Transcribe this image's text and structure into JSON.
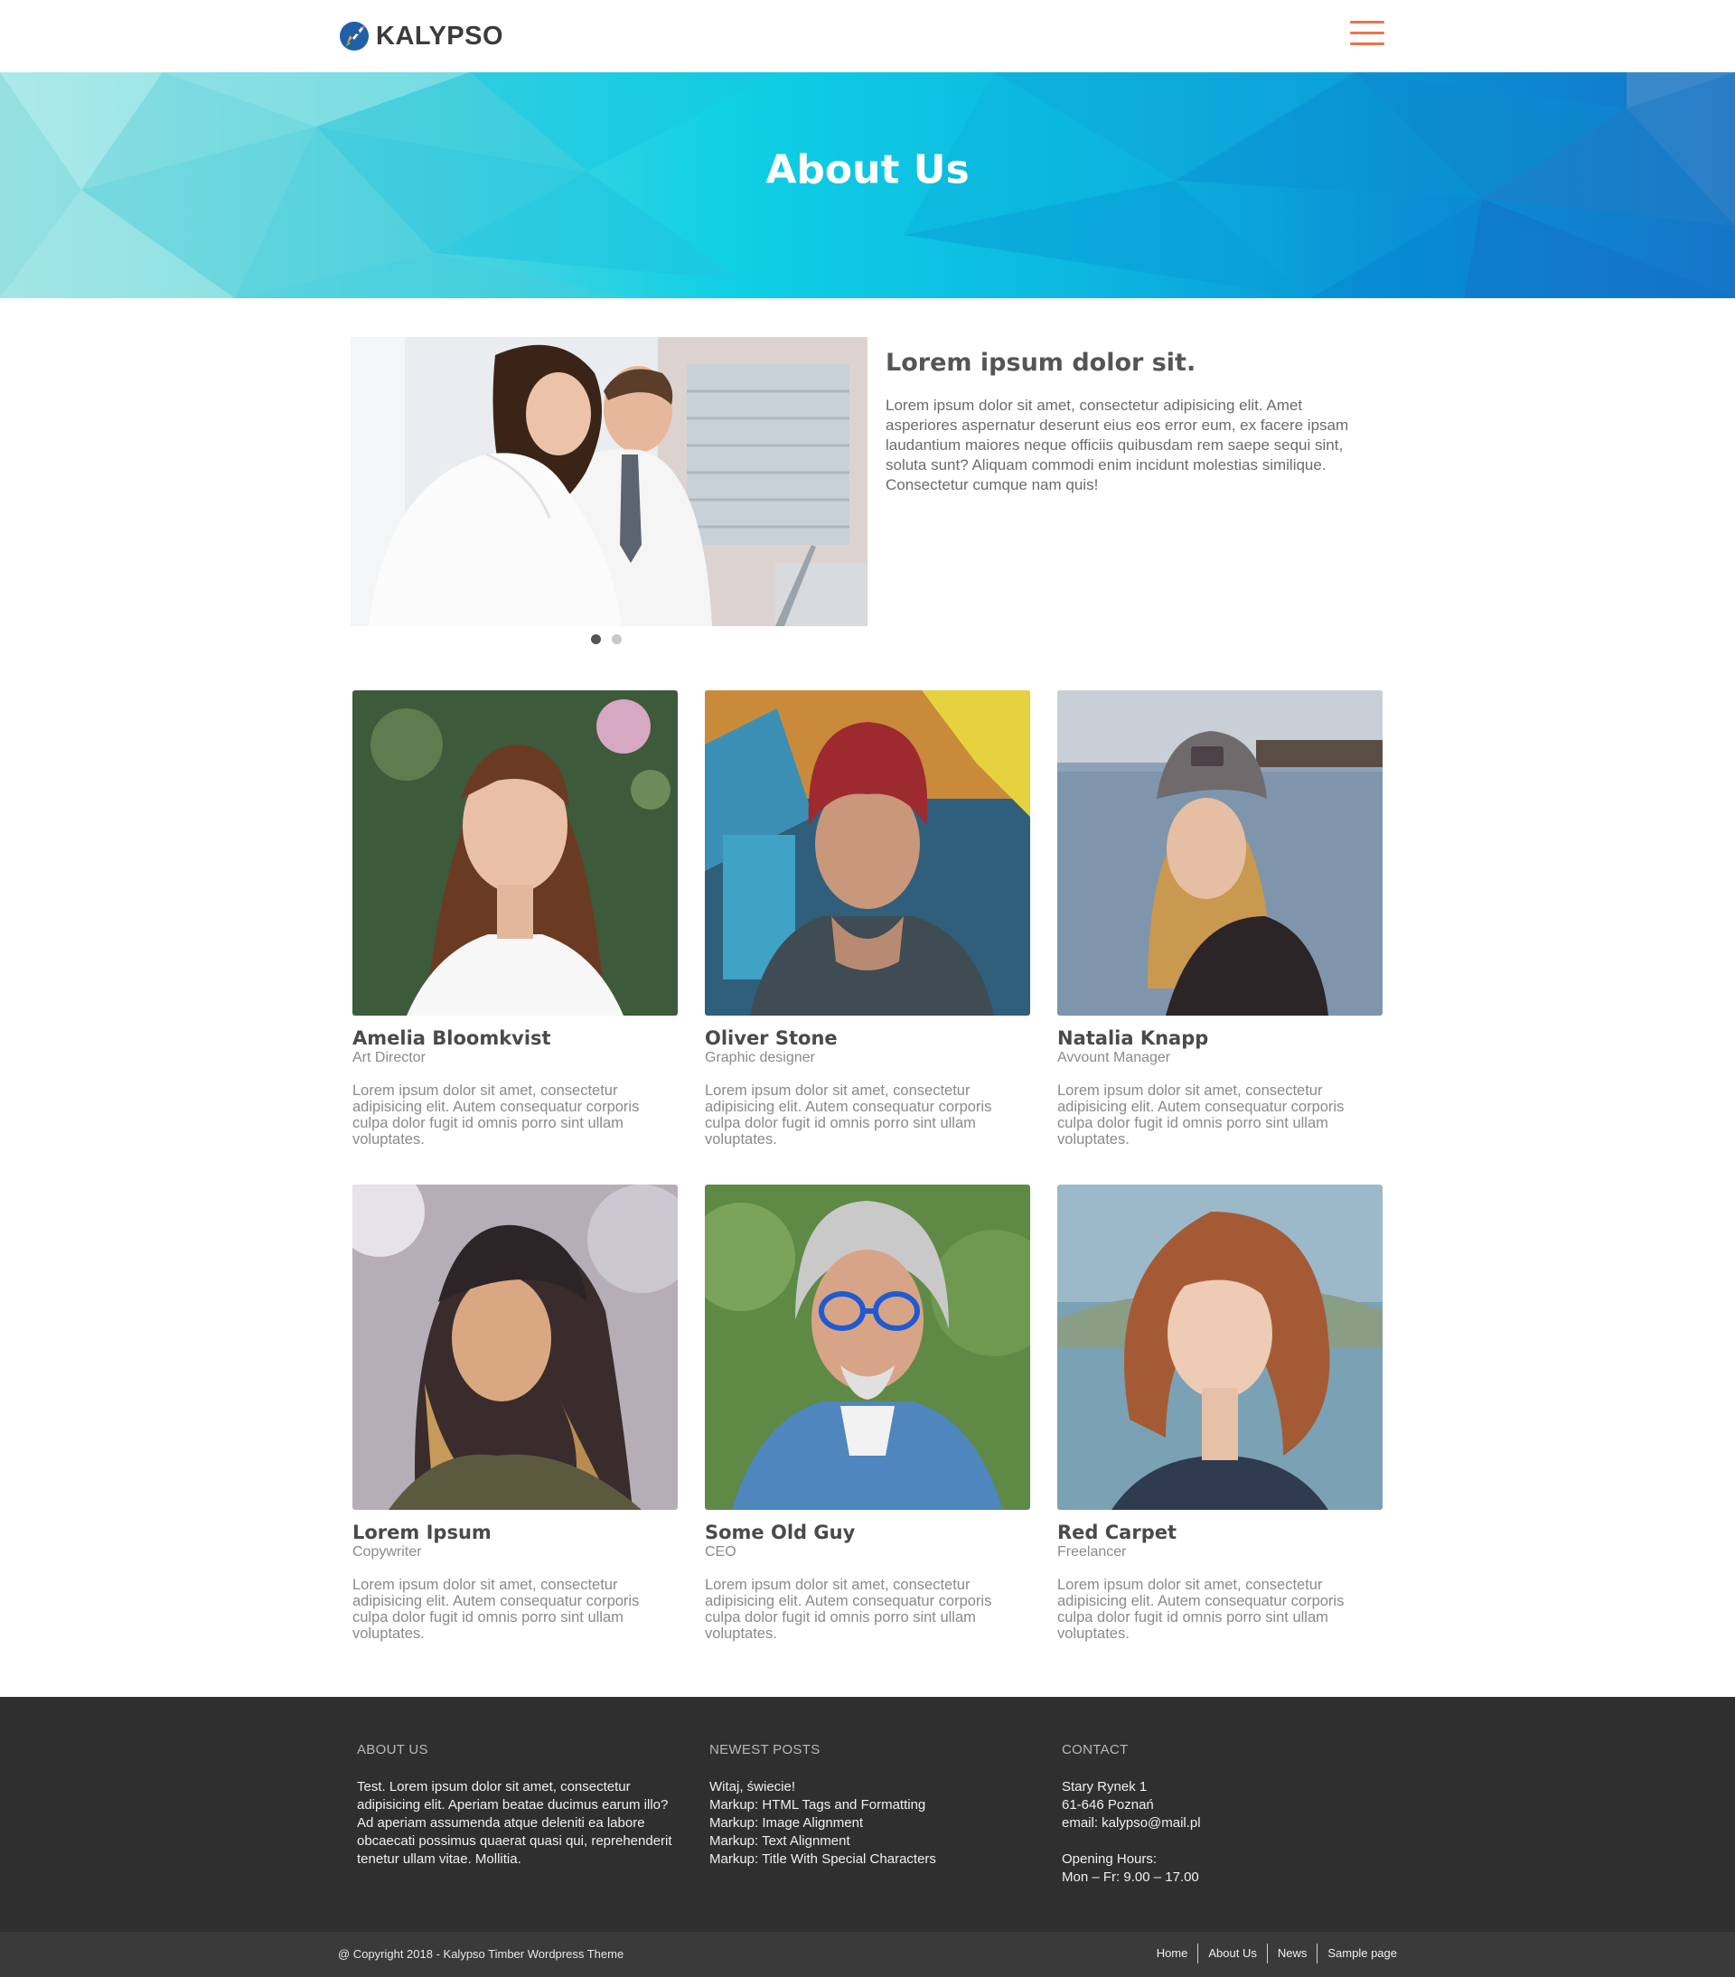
{
  "header": {
    "brand": "KALYPSO",
    "menu_icon": "hamburger-menu-icon",
    "accent_color": "#e8744f"
  },
  "hero": {
    "title": "About Us"
  },
  "intro": {
    "heading": "Lorem ipsum dolor sit.",
    "text": "Lorem ipsum dolor sit amet, consectetur adipisicing elit. Amet asperiores aspernatur deserunt eius eos error eum, ex facere ipsam laudantium maiores neque officiis quibusdam rem saepe sequi sint, soluta sunt? Aliquam commodi enim incidunt molestias similique. Consectetur cumque nam quis!",
    "slides_total": 2,
    "slide_active": 1
  },
  "team": [
    {
      "name": "Amelia Bloomkvist",
      "role": "Art Director",
      "bio": "Lorem ipsum dolor sit amet, consectetur adipisicing elit. Autem consequatur corporis culpa dolor fugit id omnis porro sint ullam voluptates."
    },
    {
      "name": "Oliver Stone",
      "role": "Graphic designer",
      "bio": "Lorem ipsum dolor sit amet, consectetur adipisicing elit. Autem consequatur corporis culpa dolor fugit id omnis porro sint ullam voluptates."
    },
    {
      "name": "Natalia Knapp",
      "role": "Avvount Manager",
      "bio": "Lorem ipsum dolor sit amet, consectetur adipisicing elit. Autem consequatur corporis culpa dolor fugit id omnis porro sint ullam voluptates."
    },
    {
      "name": "Lorem Ipsum",
      "role": "Copywriter",
      "bio": "Lorem ipsum dolor sit amet, consectetur adipisicing elit. Autem consequatur corporis culpa dolor fugit id omnis porro sint ullam voluptates."
    },
    {
      "name": "Some Old Guy",
      "role": "CEO",
      "bio": "Lorem ipsum dolor sit amet, consectetur adipisicing elit. Autem consequatur corporis culpa dolor fugit id omnis porro sint ullam voluptates."
    },
    {
      "name": "Red Carpet",
      "role": "Freelancer",
      "bio": "Lorem ipsum dolor sit amet, consectetur adipisicing elit. Autem consequatur corporis culpa dolor fugit id omnis porro sint ullam voluptates."
    }
  ],
  "footer": {
    "about": {
      "heading": "ABOUT US",
      "text": "Test. Lorem ipsum dolor sit amet, consectetur adipisicing elit. Aperiam beatae ducimus earum illo? Ad aperiam assumenda atque deleniti ea labore obcaecati possimus quaerat quasi qui, reprehenderit tenetur ullam vitae. Mollitia."
    },
    "posts": {
      "heading": "NEWEST POSTS",
      "items": [
        "Witaj, świecie!",
        "Markup: HTML Tags and Formatting",
        "Markup: Image Alignment",
        "Markup: Text Alignment",
        "Markup: Title With Special Characters"
      ]
    },
    "contact": {
      "heading": "CONTACT",
      "street": "Stary Rynek 1",
      "city": "61-646 Poznań",
      "email": "email: kalypso@mail.pl",
      "hours_label": "Opening Hours:",
      "hours": "Mon – Fr: 9.00 – 17.00"
    }
  },
  "bottom_bar": {
    "copyright": "@ Copyright 2018 - Kalypso Timber Wordpress Theme",
    "nav": [
      "Home",
      "About Us",
      "News",
      "Sample page"
    ]
  }
}
